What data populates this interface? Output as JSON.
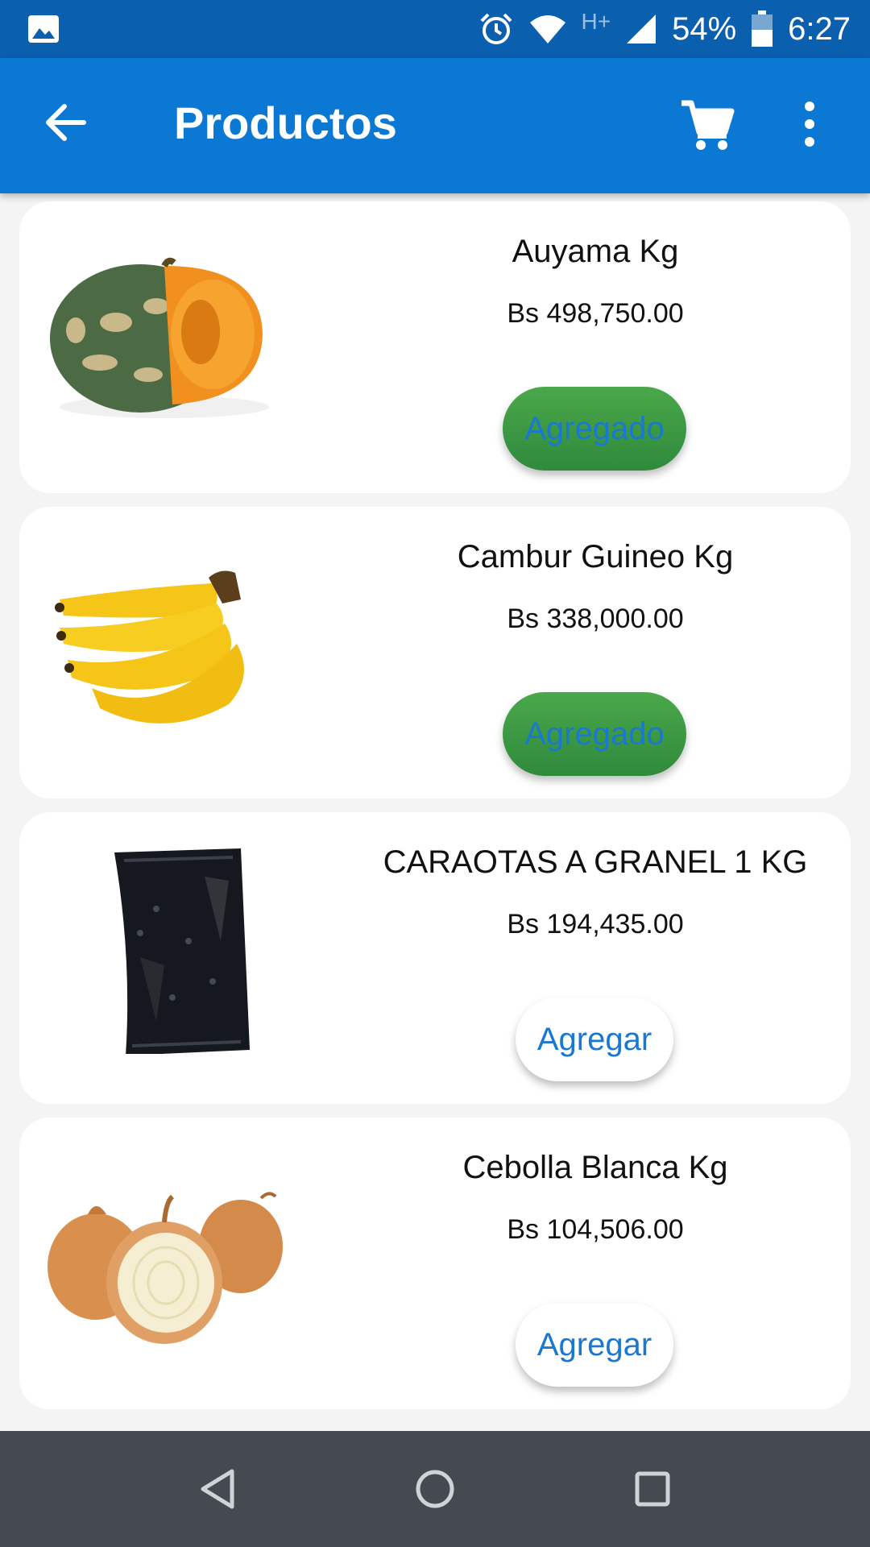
{
  "status_bar": {
    "network": "H+",
    "battery": "54%",
    "time": "6:27"
  },
  "app_bar": {
    "title": "Productos"
  },
  "products": [
    {
      "name": "Auyama Kg",
      "price": "Bs 498,750.00",
      "button": "Agregado",
      "added": true
    },
    {
      "name": "Cambur Guineo Kg",
      "price": "Bs 338,000.00",
      "button": "Agregado",
      "added": true
    },
    {
      "name": "CARAOTAS A GRANEL 1 KG",
      "price": "Bs 194,435.00",
      "button": "Agregar",
      "added": false
    },
    {
      "name": "Cebolla Blanca Kg",
      "price": "Bs 104,506.00",
      "button": "Agregar",
      "added": false
    }
  ],
  "colors": {
    "status_bar": "#0a5fae",
    "app_bar": "#0b78d4",
    "added_button": "#3d9a43",
    "button_text": "#1b78d0",
    "nav_bar": "#444a50"
  }
}
